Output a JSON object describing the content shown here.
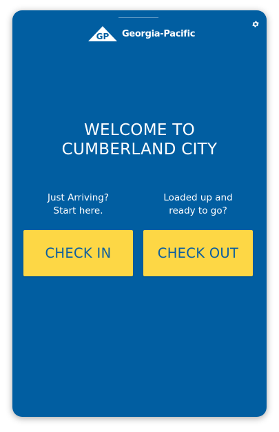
{
  "header": {
    "brand_name": "Georgia-Pacific",
    "logo_initials": "GP",
    "settings_icon": "gear-icon"
  },
  "welcome": {
    "line1": "WELCOME TO",
    "line2": "CUMBERLAND CITY"
  },
  "check_in": {
    "prompt_line1": "Just Arriving?",
    "prompt_line2": "Start here.",
    "button_label": "CHECK IN"
  },
  "check_out": {
    "prompt_line1": "Loaded up and",
    "prompt_line2": "ready to go?",
    "button_label": "CHECK OUT"
  },
  "colors": {
    "background": "#015ea1",
    "button": "#fdd745",
    "button_text": "#0b5ea0",
    "text": "#ffffff"
  }
}
